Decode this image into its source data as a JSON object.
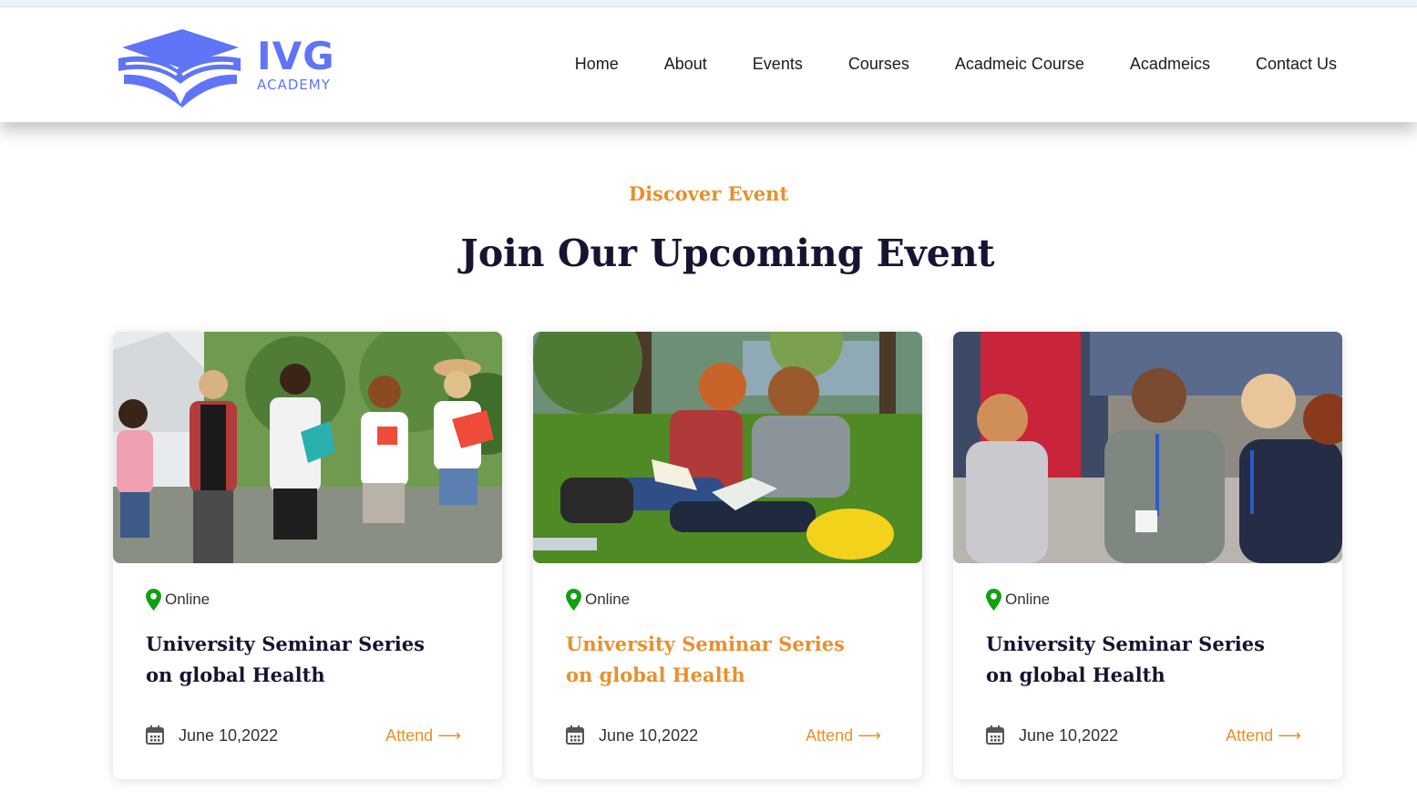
{
  "brand": {
    "name": "IVG",
    "subtitle": "ACADEMY",
    "color": "#5f74f6"
  },
  "nav": {
    "items": [
      {
        "label": "Home"
      },
      {
        "label": "About"
      },
      {
        "label": "Events"
      },
      {
        "label": "Courses"
      },
      {
        "label": "Acadmeic Course"
      },
      {
        "label": "Acadmeics"
      },
      {
        "label": "Contact Us"
      }
    ]
  },
  "section": {
    "eyebrow": "Discover Event",
    "title": "Join Our Upcoming Event"
  },
  "colors": {
    "accent": "#e8902c",
    "heading": "#151532",
    "pin": "#12a012"
  },
  "events": [
    {
      "location": "Online",
      "title": "University Seminar Series on global Health",
      "date": "June 10,2022",
      "action": "Attend",
      "action_icon": "⟶",
      "image": "students-walking-photo"
    },
    {
      "location": "Online",
      "title": "University Seminar Series on global Health",
      "date": "June 10,2022",
      "action": "Attend",
      "action_icon": "⟶",
      "image": "students-reading-on-grass-photo",
      "highlighted": true
    },
    {
      "location": "Online",
      "title": "University Seminar Series on global Health",
      "date": "June 10,2022",
      "action": "Attend",
      "action_icon": "⟶",
      "image": "students-talking-photo"
    }
  ]
}
